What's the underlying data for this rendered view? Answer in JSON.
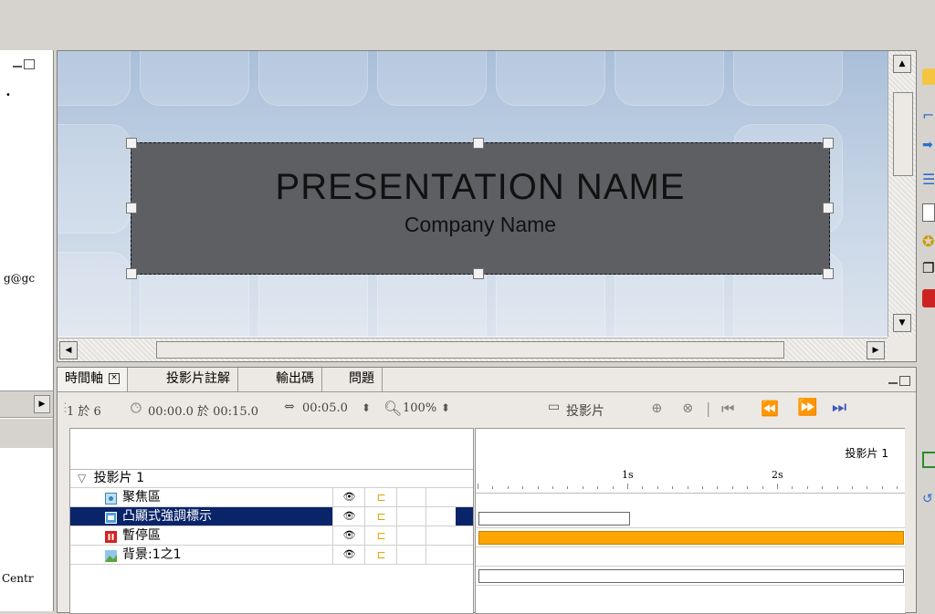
{
  "left_panel": {
    "email_fragment": "g@gc",
    "centr_fragment": "Centr"
  },
  "slide": {
    "title": "PRESENTATION  NAME",
    "subtitle": "Company Name"
  },
  "tabs": [
    {
      "label": "時間軸",
      "active": true
    },
    {
      "label": "投影片註解"
    },
    {
      "label": "輸出碼"
    },
    {
      "label": "問題"
    }
  ],
  "controls": {
    "slide_counter": "1 於 6",
    "time_range": "00:00.0 於 00:15.0",
    "duration": "00:05.0",
    "zoom": "100%",
    "slide_label": "投影片"
  },
  "layers": [
    {
      "label": "投影片 1",
      "type": "group"
    },
    {
      "label": "聚焦區",
      "icon": "zoom-area-icon"
    },
    {
      "label": "凸顯式強調標示",
      "icon": "highlight-box-icon",
      "selected": true
    },
    {
      "label": "暫停區",
      "icon": "pause-icon"
    },
    {
      "label": "背景:1之1",
      "icon": "background-image-icon"
    }
  ],
  "timeline": {
    "header": "投影片 1",
    "ticks": [
      "1s",
      "2s"
    ],
    "bars": [
      {
        "layer": "聚焦區",
        "start": 0.0,
        "end": 1.0,
        "color": "#ffffff"
      },
      {
        "layer": "凸顯式強調標示",
        "start": 0.0,
        "end": 3.0,
        "color": "#ffa500"
      },
      {
        "layer": "暫停區",
        "start": 0.0,
        "end": 0.0,
        "color": "#ffffff"
      },
      {
        "layer": "背景:1之1",
        "start": 0.0,
        "end": 3.0,
        "color": "#ffffff"
      }
    ]
  }
}
